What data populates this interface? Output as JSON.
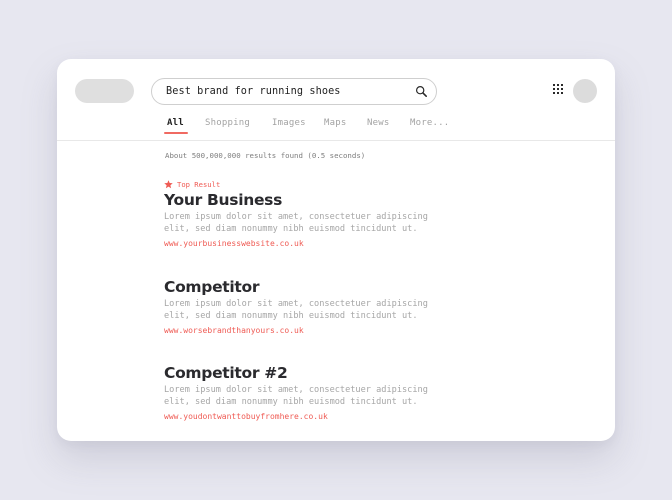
{
  "search": {
    "query": "Best brand for running shoes",
    "icon": "search-icon"
  },
  "header": {
    "apps_icon": "apps-grid-icon",
    "avatar": "avatar"
  },
  "tabs": [
    {
      "label": "All",
      "active": true
    },
    {
      "label": "Shopping",
      "active": false
    },
    {
      "label": "Images",
      "active": false
    },
    {
      "label": "Maps",
      "active": false
    },
    {
      "label": "News",
      "active": false
    },
    {
      "label": "More...",
      "active": false
    }
  ],
  "stats": "About 500,000,000 results found (0.5 seconds)",
  "results": [
    {
      "badge": "Top Result",
      "title": "Your Business",
      "description": [
        "Lorem ipsum dolor sit amet, consectetuer adipiscing",
        "elit, sed diam nonummy nibh euismod tincidunt ut."
      ],
      "url": "www.yourbusinesswebsite.co.uk"
    },
    {
      "title": "Competitor",
      "description": [
        "Lorem ipsum dolor sit amet, consectetuer adipiscing",
        "elit, sed diam nonummy nibh euismod tincidunt ut."
      ],
      "url": "www.worsebrandthanyours.co.uk"
    },
    {
      "title": "Competitor #2",
      "description": [
        "Lorem ipsum dolor sit amet, consectetuer adipiscing",
        "elit, sed diam nonummy nibh euismod tincidunt ut."
      ],
      "url": "www.youdontwanttobuyfromhere.co.uk"
    }
  ],
  "colors": {
    "accent": "#ef5b54",
    "background": "#e7e7f0",
    "card": "#ffffff",
    "title": "#2a2a2e",
    "muted": "#a6a6a6"
  }
}
